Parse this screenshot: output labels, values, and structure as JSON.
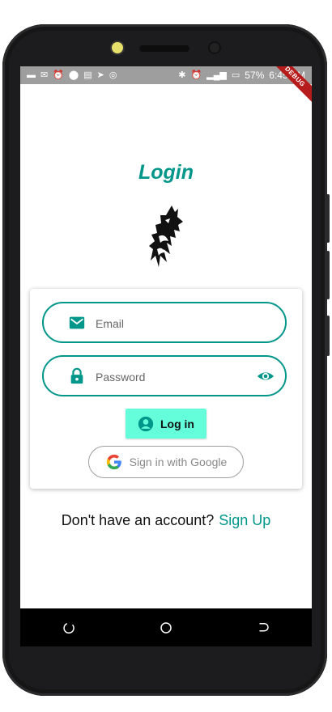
{
  "status_bar": {
    "battery": "57%",
    "time": "6:45 PM",
    "debug_banner": "DEBUG"
  },
  "login": {
    "title": "Login",
    "email_placeholder": "Email",
    "password_placeholder": "Password",
    "login_button": "Log in",
    "google_button": "Sign in with Google",
    "signup_prompt": "Don't have an account?",
    "signup_link": "Sign Up"
  },
  "colors": {
    "accent": "#00968a",
    "login_button_bg": "#64ffda",
    "status_bar_bg": "#9e9e9e",
    "nav_bar_bg": "#000000"
  },
  "icons": {
    "email": "mail-icon",
    "password": "lock-icon",
    "visibility": "eye-icon",
    "login": "account-circle-icon",
    "google": "google-logo-icon",
    "nav": [
      "back-icon",
      "home-icon",
      "recents-icon"
    ]
  }
}
